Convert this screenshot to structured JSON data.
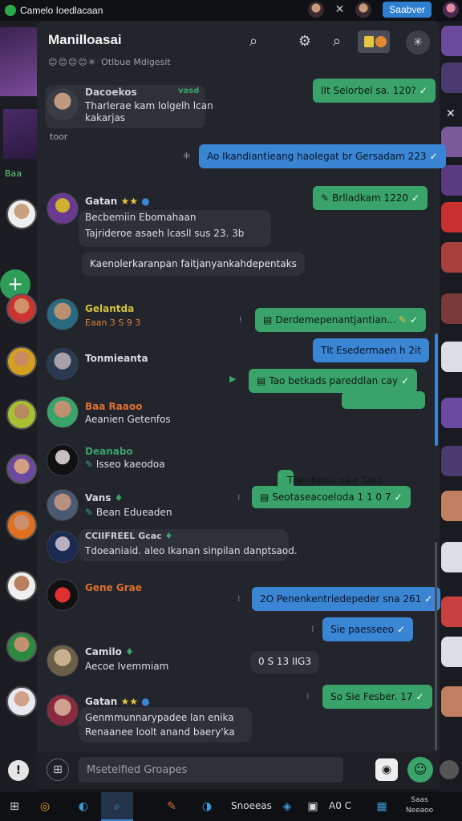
{
  "topbar": {
    "title": "Camelo Ioedlacaan",
    "badge": "Saabver"
  },
  "header": {
    "title": "Manilloasai",
    "subtitle": "Otlbue Mdlgesit",
    "emojis": "😊😊😊😊✳"
  },
  "rail": {
    "tag": "Baa"
  },
  "messages": {
    "out1": "IIt Selorbel sa. 120?",
    "in1_name": "Dacoekos",
    "in1_tag": "vasd",
    "in1_line1": "Tharlerae kam lolgelh lcan",
    "in1_line2": "kakarjas",
    "in1_ts": "toor",
    "out2": "Ao Ikandiantieang haolegat br Gersadam 223",
    "out3": "Brlladkam 1220",
    "in2_name": "Gatan",
    "in2_line1": "Becbemiin Ebomahaan",
    "in2_line2": "Tajrideroe asaeh lcasll sus 23. 3b",
    "in2_bubble": "Kaenolerkaranpan faitjanyankahdepentaks",
    "in3_name": "Gelantda",
    "in3_sub": "Eaan 3 S 9 3",
    "out4": "Derdemepenantjantian...",
    "in4_name": "Tonmieanta",
    "out5": "Tlt Esedermaen h 2it",
    "out6": "Tao betkads pareddlan cay",
    "in5_name": "Baa Raaoo",
    "in5_sub": "Aeanien Getenfos",
    "in6_name": "Deanabo",
    "in6_sub": "Isseo kaeodoa",
    "out7_top": "Tnenhend oike Takb",
    "out7": "Seotaseacoeloda    1   1 0 7",
    "in7_name": "Vans",
    "in7_sub": "Bean Edueaden",
    "in8_name": "CCIIFREEL",
    "in8_tag": "Gcac",
    "in8_bubble": "Tdoeaniaid. aleo Ikanan sinpilan danptsaod.",
    "in9_name": "Gene Grae",
    "out8": "2O Penenkentriedepeder sna 261",
    "out9": "Sie paesseeo",
    "in10_name": "Camilo",
    "in10_sub": "Aecoe Ivemmiam",
    "in10_ts": "0  S 13  IIG3",
    "out10": "So Sie Fesber. 17",
    "in11_name": "Gatan",
    "in11_line1": "Genmmunnarypadee lan enika",
    "in11_line2": "Renaanee loolt anand baery'ka"
  },
  "composer": {
    "placeholder": "Msetelfied Groapes"
  },
  "taskbar": {
    "label1": "Snoeeas",
    "label2": "A0 C",
    "clock_line1": "Saas",
    "clock_line2": "Neeaoo"
  },
  "colors": {
    "green_bubble": "#3aa36a",
    "blue_bubble": "#3a86d4",
    "panel": "#22252b"
  }
}
